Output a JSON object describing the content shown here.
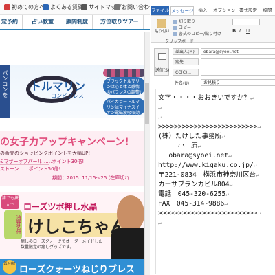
{
  "site": {
    "top_links": [
      {
        "label": "初めての方へ",
        "icon": "question-circle-icon",
        "color": "#d33b3b"
      },
      {
        "label": "よくある質問",
        "icon": "q-icon",
        "color": "#2b66b5"
      },
      {
        "label": "サイトマップ",
        "icon": "sitemap-icon",
        "color": "#555555"
      },
      {
        "label": "お問い合わせ",
        "icon": "envelope-icon",
        "color": "#777777"
      }
    ],
    "nav": [
      "定予約",
      "占い教室",
      "顧問制度",
      "方位取りツアー"
    ],
    "banner1": {
      "side_text": "パンコンを",
      "title": "トルマリン",
      "subtitle": "コンビブレス",
      "bubble1": "ブラックトルマリンは心と体と感情のバランスの調整♪",
      "bubble2": "パイカラートルマリンはマイナスイオン電磁波吸収効果♪"
    },
    "banner2": {
      "title": "の女子力アップキャンペーン!",
      "line1": "の販売のショッピングポイントを大幅UP!",
      "line2": "&マザーオブパール……ポイント30倍!",
      "line3": "ストーン……ポイント50倍!",
      "period": "期間：2015. 11/15～25 (在庫切れ"
    },
    "banner3": {
      "tag": "誰でも挟んで",
      "title": "ローズツボ押し水晶",
      "name": "けしこちゃん",
      "seal": "浅野名付",
      "desc1": "癒しのローズクォーツでオーダーメイドした",
      "desc2": "数量限定の癒しグッズです。"
    },
    "banner4": {
      "tag": "再入荷!",
      "title": "ローズクォーツねじりブレス"
    }
  },
  "mail": {
    "tabs": [
      "ファイル",
      "メッセージ",
      "挿入",
      "オプション",
      "書式設定",
      "校閲"
    ],
    "ribbon": {
      "paste_label": "貼り付け",
      "cut_label": "切り取り",
      "copy_label": "コピー",
      "format_painter_label": "書式のコピー/貼り付け",
      "clipboard_label": "クリップボード",
      "font_group": "B I U"
    },
    "header": {
      "send_label": "送信(S)",
      "from_label": "差出人(M)",
      "from_value": "obara@syoei.net",
      "to_label": "宛先...",
      "to_value": "",
      "cc_label": "CC(C)...",
      "cc_value": "",
      "subject_label": "件名(U)",
      "subject_value": "お見積り"
    },
    "body_lines": [
      "文字・・・・おおきいですか？",
      "",
      "",
      ">>>>>>>>>>>>>>>>>>>>>>>>>",
      "(株）たけした事務所",
      "　　　小　原",
      "　 obara@syoei.net",
      "http://www.kigaku.co.jp/",
      "〒221-0834　横浜市神奈川区台",
      "カーサブランカビル804",
      "電話　045-320-6255",
      "FAX　045-314-9886",
      ">>>>>>>>>>>>>>>>>>>>>>>>>"
    ]
  }
}
